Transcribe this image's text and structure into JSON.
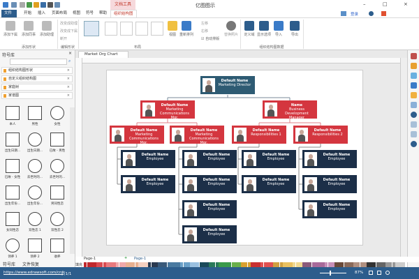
{
  "app": {
    "title": "亿图图示",
    "context_tab": "文档工具"
  },
  "tabs": [
    "文件",
    "开始",
    "插入",
    "页面布局",
    "视图",
    "符号",
    "帮助",
    "组织结构图"
  ],
  "ribbon": {
    "add_group": {
      "buttons": [
        "添加下属",
        "添加同事",
        "添加助理"
      ],
      "label": "添加形状"
    },
    "edit_group": {
      "buttons": [
        "改变成助理",
        "改变成下属",
        "断开"
      ],
      "label": "编辑形状"
    },
    "layout_group": {
      "buttons": [
        "视图",
        "重新排列"
      ],
      "label": "布局"
    },
    "move_group": {
      "buttons": [
        "左移",
        "右移",
        "自动排版"
      ],
      "auto_checked": true
    },
    "photo_button": "替换照片",
    "data_group": {
      "buttons": [
        "定义域",
        "显示选项",
        "导入",
        "导出"
      ],
      "label": "组织结构图数据"
    },
    "login": "登录"
  },
  "document_tab": "Market Org Chart",
  "library": {
    "title": "符号库",
    "sections": [
      "组织结构图形状",
      "自定义组织结构图",
      "家庭树",
      "家谱图"
    ],
    "symbols": [
      "本人",
      "男性",
      "女性",
      "出生日期...",
      "出生日期...",
      "已故 - 男性",
      "已故 - 女性",
      "去世时的...",
      "去世时的...",
      "出生年份...",
      "出生年份...",
      "男同性恋",
      "女同性恋",
      "双性恋 1",
      "双性恋 2",
      "领养 1",
      "领养 2",
      "收养"
    ],
    "tabs": [
      "符号库",
      "文件恢复"
    ]
  },
  "org": {
    "colors": {
      "director": "#2e5b73",
      "manager": "#d4363f",
      "employee": "#1c2f48"
    },
    "director": {
      "name": "Default Name",
      "role": "Marketing Director"
    },
    "managers": [
      {
        "name": "Default Name",
        "role": "Marketing Communications Mgr."
      },
      {
        "name": "Name",
        "role": "Business Development Manager"
      }
    ],
    "leads": [
      {
        "name": "Default Name",
        "role": "Marketing Communications Mgr."
      },
      {
        "name": "Default Name",
        "role": "Marketing Communications Mgr."
      },
      {
        "name": "Default Name",
        "role": "Responsibilities 1"
      },
      {
        "name": "Default Name",
        "role": "Responsibilities 2"
      }
    ],
    "employee": {
      "name": "Default Name",
      "role": "Employee"
    },
    "employee_counts": [
      2,
      4,
      2,
      3
    ]
  },
  "pages": {
    "current": "Page-1",
    "tab": "Page-1"
  },
  "palette_label": "填充",
  "status": {
    "url": "https://www.edrawsoft.com/cn/",
    "page": "页1/1",
    "zoom": "87%"
  }
}
